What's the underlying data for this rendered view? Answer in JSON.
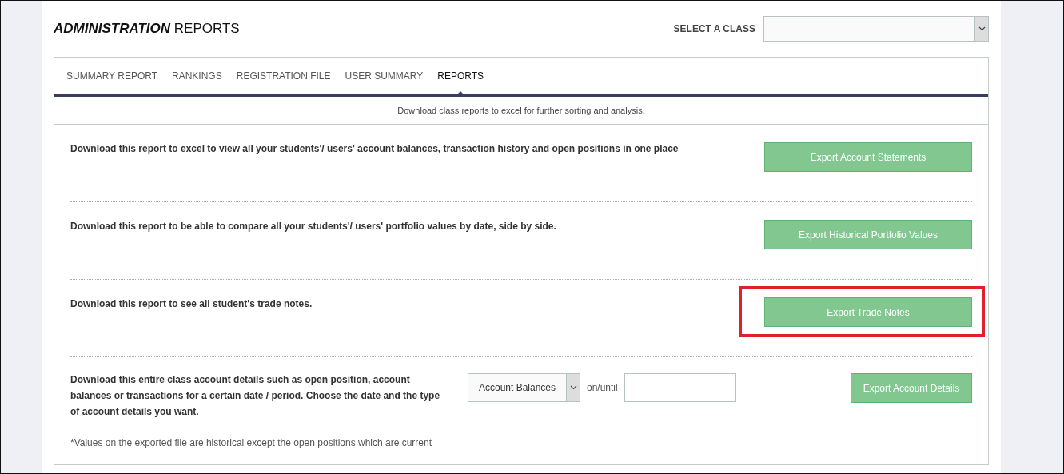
{
  "header": {
    "title_bold": "ADMINISTRATION",
    "title_rest": "REPORTS",
    "class_label": "SELECT A CLASS"
  },
  "tabs": [
    {
      "label": "SUMMARY REPORT",
      "selected": false
    },
    {
      "label": "RANKINGS",
      "selected": false
    },
    {
      "label": "REGISTRATION FILE",
      "selected": false
    },
    {
      "label": "USER SUMMARY",
      "selected": false
    },
    {
      "label": "REPORTS",
      "selected": true
    }
  ],
  "intro": "Download class reports to excel for further sorting and analysis.",
  "reports": [
    {
      "kind": "simple",
      "description": "Download this report to excel to view all your students'/ users' account balances, transaction history and open positions in one place",
      "button": "Export Account Statements",
      "highlighted": false
    },
    {
      "kind": "simple",
      "description": "Download this report to be able to compare all your students'/ users' portfolio values by date, side by side.",
      "button": "Export Historical Portfolio Values",
      "highlighted": false
    },
    {
      "kind": "simple",
      "description": "Download this report to see all student's trade notes.",
      "button": "Export Trade Notes",
      "highlighted": true
    },
    {
      "kind": "details",
      "description": "Download this entire class account details such as open position, account balances or transactions for a certain date / period. Choose the date and the type of account details you want.",
      "select_value": "Account Balances",
      "date_label": "on/until",
      "button": "Export Account Details",
      "note": "*Values on the exported file are historical except the open positions which are current",
      "highlighted": false
    }
  ]
}
